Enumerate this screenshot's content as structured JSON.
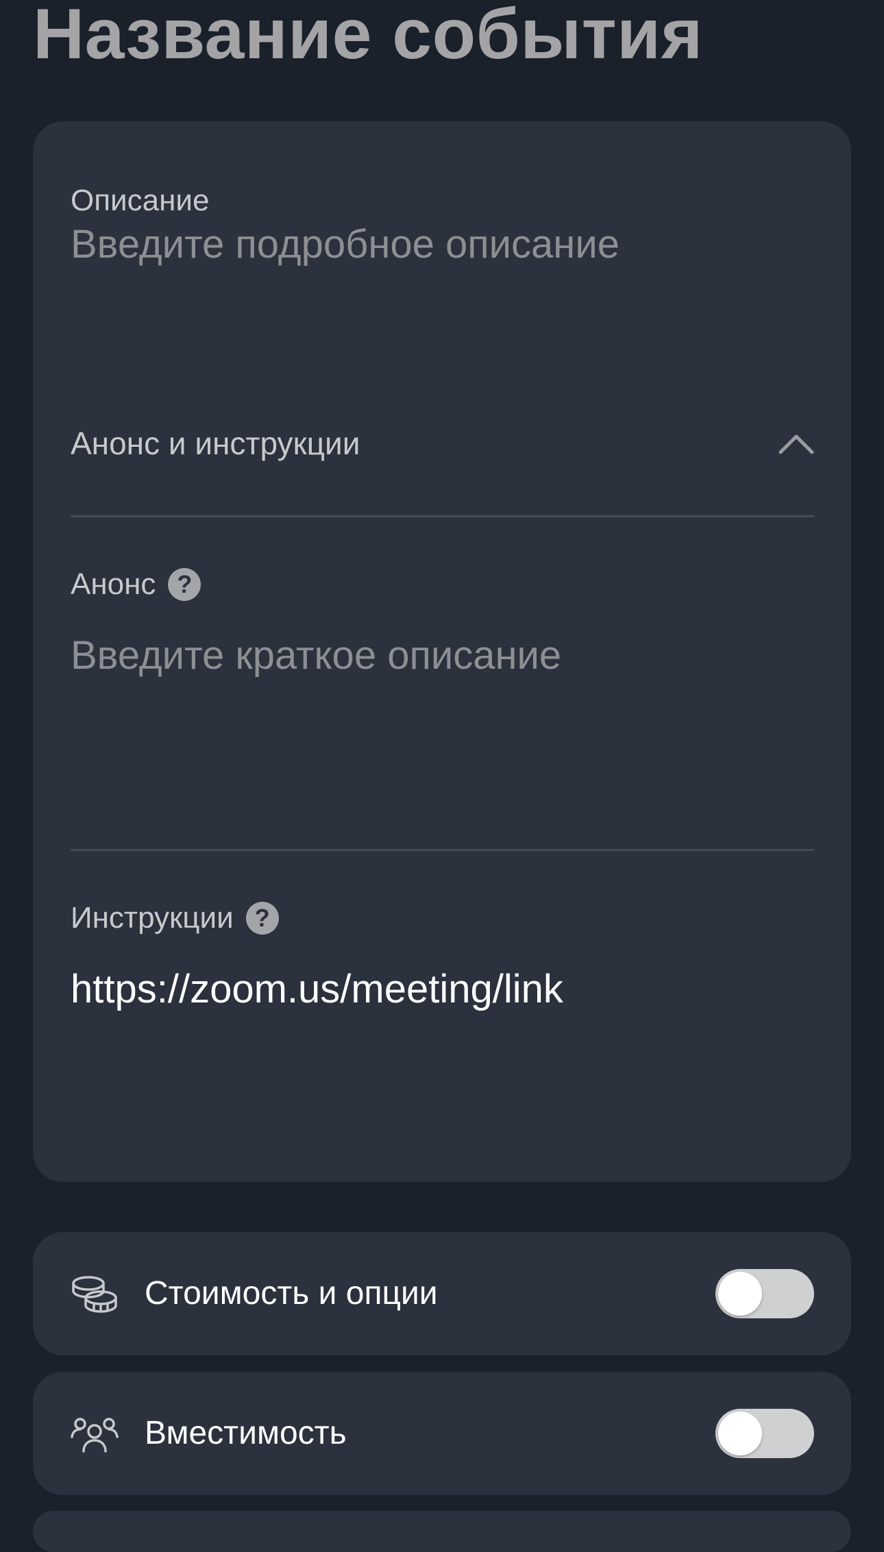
{
  "page": {
    "title": "Название события"
  },
  "description": {
    "label": "Описание",
    "value": "",
    "placeholder": "Введите подробное описание"
  },
  "announcement_section": {
    "header_label": "Анонс и инструкции",
    "expanded": true,
    "announcement": {
      "label": "Анонс",
      "help_icon": "question-circle-icon",
      "value": "",
      "placeholder": "Введите краткое описание"
    },
    "instructions": {
      "label": "Инструкции",
      "help_icon": "question-circle-icon",
      "value": "https://zoom.us/meeting/link",
      "placeholder": ""
    }
  },
  "toggles": [
    {
      "label": "Стоимость и опции",
      "icon": "coins-icon",
      "enabled": false
    },
    {
      "label": "Вместимость",
      "icon": "people-group-icon",
      "enabled": false
    }
  ],
  "colors": {
    "background": "#1a212b",
    "card": "#2b313d",
    "title": "#a4a4a6",
    "placeholder": "#8d8f93",
    "switch_off": "#cfd0d2"
  }
}
